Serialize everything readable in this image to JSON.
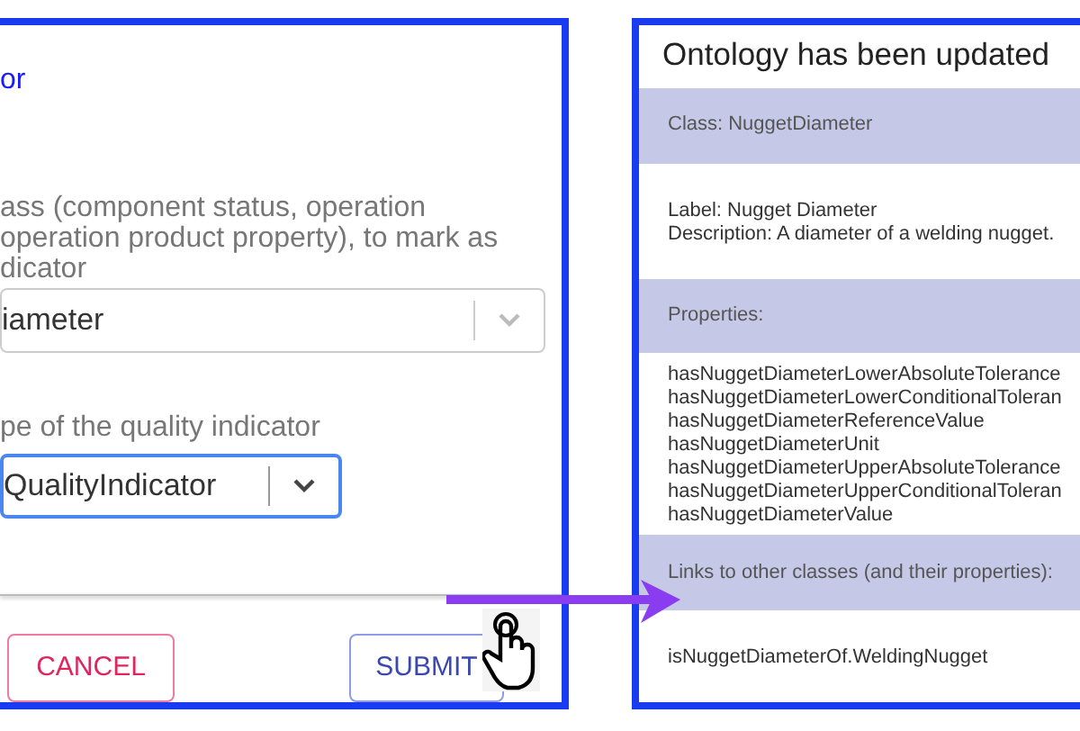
{
  "left_panel": {
    "link": "or",
    "class_hint_lines": [
      "ass (component status, operation",
      "operation product property), to mark as",
      "dicator"
    ],
    "class_select": {
      "value": "iameter",
      "focused": false
    },
    "type_label": "pe of the quality indicator",
    "type_select": {
      "value": "QualityIndicator",
      "focused": true
    },
    "buttons": [
      {
        "label": "CANCEL",
        "kind": "cancel"
      },
      {
        "label": "SUBMIT",
        "kind": "submit"
      }
    ]
  },
  "right_panel": {
    "title": "Ontology has been updated",
    "sections": [
      {
        "kind": "header",
        "lines": [
          "Class: NuggetDiameter"
        ]
      },
      {
        "kind": "body",
        "lines": [
          "Label: Nugget Diameter",
          "Description: A diameter of a welding nugget."
        ]
      },
      {
        "kind": "header",
        "lines": [
          "Properties:"
        ]
      },
      {
        "kind": "list",
        "lines": [
          "hasNuggetDiameterLowerAbsoluteTolerance",
          "hasNuggetDiameterLowerConditionalToleran",
          "hasNuggetDiameterReferenceValue",
          "hasNuggetDiameterUnit",
          "hasNuggetDiameterUpperAbsoluteTolerance",
          "hasNuggetDiameterUpperConditionalToleran",
          "hasNuggetDiameterValue"
        ]
      },
      {
        "kind": "header",
        "lines": [
          "Links to other classes (and their properties):"
        ]
      },
      {
        "kind": "body",
        "lines": [
          "isNuggetDiameterOf.WeldingNugget"
        ]
      }
    ]
  }
}
